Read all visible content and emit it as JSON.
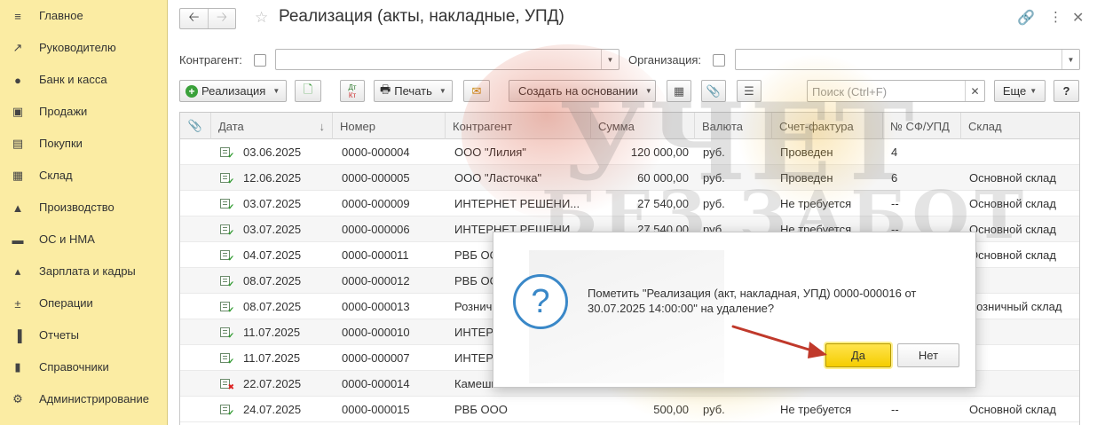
{
  "sidebar": {
    "items": [
      {
        "label": "Главное",
        "icon": "menu-icon"
      },
      {
        "label": "Руководителю",
        "icon": "trend-icon"
      },
      {
        "label": "Банк и касса",
        "icon": "coin-icon"
      },
      {
        "label": "Продажи",
        "icon": "bag-icon"
      },
      {
        "label": "Покупки",
        "icon": "cart-icon"
      },
      {
        "label": "Склад",
        "icon": "warehouse-icon"
      },
      {
        "label": "Производство",
        "icon": "factory-icon"
      },
      {
        "label": "ОС и НМА",
        "icon": "truck-icon"
      },
      {
        "label": "Зарплата и кадры",
        "icon": "person-icon"
      },
      {
        "label": "Операции",
        "icon": "dt-kt-icon"
      },
      {
        "label": "Отчеты",
        "icon": "bar-chart-icon"
      },
      {
        "label": "Справочники",
        "icon": "books-icon"
      },
      {
        "label": "Администрирование",
        "icon": "gear-icon"
      }
    ]
  },
  "header": {
    "title": "Реализация (акты, накладные, УПД)"
  },
  "filters": {
    "counterparty_label": "Контрагент:",
    "organization_label": "Организация:"
  },
  "toolbar": {
    "create_label": "Реализация",
    "print_label": "Печать",
    "create_based_label": "Создать на основании",
    "search_placeholder": "Поиск (Ctrl+F)",
    "more_label": "Еще",
    "help_label": "?",
    "dtkt_top": "Дт",
    "dtkt_bottom": "Кт"
  },
  "table": {
    "columns": [
      "Дата",
      "Номер",
      "Контрагент",
      "Сумма",
      "Валюта",
      "Счет-фактура",
      "№ СФ/УПД",
      "Склад"
    ],
    "rows": [
      {
        "date": "03.06.2025",
        "number": "0000-000004",
        "counterparty": "ООО \"Лилия\"",
        "sum": "120 000,00",
        "currency": "руб.",
        "invoice": "Проведен",
        "inv_no": "4",
        "warehouse": "",
        "deleted": false
      },
      {
        "date": "12.06.2025",
        "number": "0000-000005",
        "counterparty": "ООО \"Ласточка\"",
        "sum": "60 000,00",
        "currency": "руб.",
        "invoice": "Проведен",
        "inv_no": "6",
        "warehouse": "Основной склад",
        "deleted": false
      },
      {
        "date": "03.07.2025",
        "number": "0000-000009",
        "counterparty": "ИНТЕРНЕТ РЕШЕНИ...",
        "sum": "27 540,00",
        "currency": "руб.",
        "invoice": "Не требуется",
        "inv_no": "--",
        "warehouse": "Основной склад",
        "deleted": false
      },
      {
        "date": "03.07.2025",
        "number": "0000-000006",
        "counterparty": "ИНТЕРНЕТ РЕШЕНИ...",
        "sum": "27 540,00",
        "currency": "руб.",
        "invoice": "Не требуется",
        "inv_no": "--",
        "warehouse": "Основной склад",
        "deleted": false
      },
      {
        "date": "04.07.2025",
        "number": "0000-000011",
        "counterparty": "РВБ ООО",
        "sum": "",
        "currency": "",
        "invoice": "",
        "inv_no": "",
        "warehouse": "Основной склад",
        "deleted": false
      },
      {
        "date": "08.07.2025",
        "number": "0000-000012",
        "counterparty": "РВБ ООО",
        "sum": "",
        "currency": "",
        "invoice": "",
        "inv_no": "",
        "warehouse": "",
        "deleted": false
      },
      {
        "date": "08.07.2025",
        "number": "0000-000013",
        "counterparty": "Розничный",
        "sum": "",
        "currency": "",
        "invoice": "",
        "inv_no": "",
        "warehouse": "Розничный склад",
        "deleted": false
      },
      {
        "date": "11.07.2025",
        "number": "0000-000010",
        "counterparty": "ИНТЕРНЕТ",
        "sum": "",
        "currency": "",
        "invoice": "",
        "inv_no": "",
        "warehouse": "",
        "deleted": false
      },
      {
        "date": "11.07.2025",
        "number": "0000-000007",
        "counterparty": "ИНТЕРНЕТ",
        "sum": "",
        "currency": "",
        "invoice": "",
        "inv_no": "",
        "warehouse": "",
        "deleted": false
      },
      {
        "date": "22.07.2025",
        "number": "0000-000014",
        "counterparty": "Камешки",
        "sum": "",
        "currency": "",
        "invoice": "",
        "inv_no": "",
        "warehouse": "",
        "deleted": true
      },
      {
        "date": "24.07.2025",
        "number": "0000-000015",
        "counterparty": "РВБ ООО",
        "sum": "500,00",
        "currency": "руб.",
        "invoice": "Не требуется",
        "inv_no": "--",
        "warehouse": "Основной склад",
        "deleted": false
      }
    ]
  },
  "dialog": {
    "message": "Пометить \"Реализация (акт, накладная, УПД) 0000-000016 от 30.07.2025 14:00:00\" на удаление?",
    "yes_label": "Да",
    "no_label": "Нет"
  },
  "watermark": {
    "line1": "УЧЕТ",
    "line2": "БЕЗ ЗАБОТ"
  },
  "colors": {
    "sidebar_bg": "#fbeca3",
    "yes_button": "#f5cd00",
    "question_icon": "#3a88c8",
    "arrow": "#c0392b"
  }
}
